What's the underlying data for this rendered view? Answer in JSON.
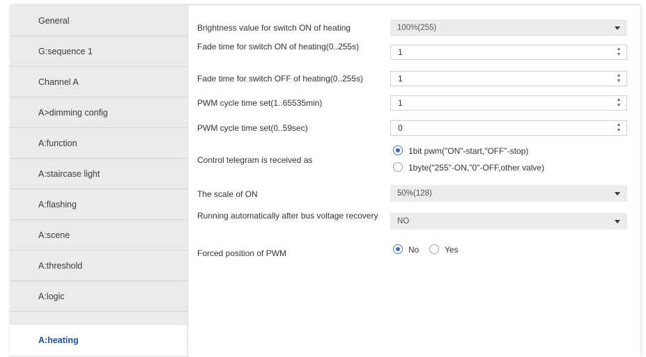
{
  "sidebar": {
    "items": [
      {
        "label": "General"
      },
      {
        "label": "G:sequence 1"
      },
      {
        "label": "Channel A"
      },
      {
        "label": "A>dimming config"
      },
      {
        "label": "A:function"
      },
      {
        "label": "A:staircase light"
      },
      {
        "label": "A:flashing"
      },
      {
        "label": "A:scene"
      },
      {
        "label": "A:threshold"
      },
      {
        "label": "A:logic"
      },
      {
        "label": "A:heating"
      }
    ],
    "active_index": 10
  },
  "params": {
    "brightness_on": {
      "label": "Brightness value for switch ON of heating",
      "value": "100%(255)"
    },
    "fade_on": {
      "label": "Fade time for switch ON of heating(0..255s)",
      "value": "1"
    },
    "fade_off": {
      "label": "Fade time for switch OFF of heating(0..255s)",
      "value": "1"
    },
    "pwm_min": {
      "label": "PWM cycle time set(1..65535min)",
      "value": "1"
    },
    "pwm_sec": {
      "label": "PWM cycle time set(0..59sec)",
      "value": "0"
    },
    "control_telegram": {
      "label": "Control telegram is received as",
      "options": [
        "1bit pwm(\"ON\"-start,\"OFF\"-stop)",
        "1byte(\"255\"-ON,\"0\"-OFF,other valve)"
      ],
      "selected": 0
    },
    "scale_on": {
      "label": "The scale of ON",
      "value": "50%(128)"
    },
    "running_auto": {
      "label": "Running automatically after bus voltage recovery",
      "value": "NO"
    },
    "forced_pwm": {
      "label": "Forced position of PWM",
      "options": [
        "No",
        "Yes"
      ],
      "selected": 0
    }
  },
  "colors": {
    "accent": "#1c4f9c",
    "sidebar_bg": "#ebebeb",
    "dropdown_bg": "#ececec"
  },
  "icons": {
    "dropdown": "caret-down-icon",
    "spin": "spin-arrows-icon"
  }
}
